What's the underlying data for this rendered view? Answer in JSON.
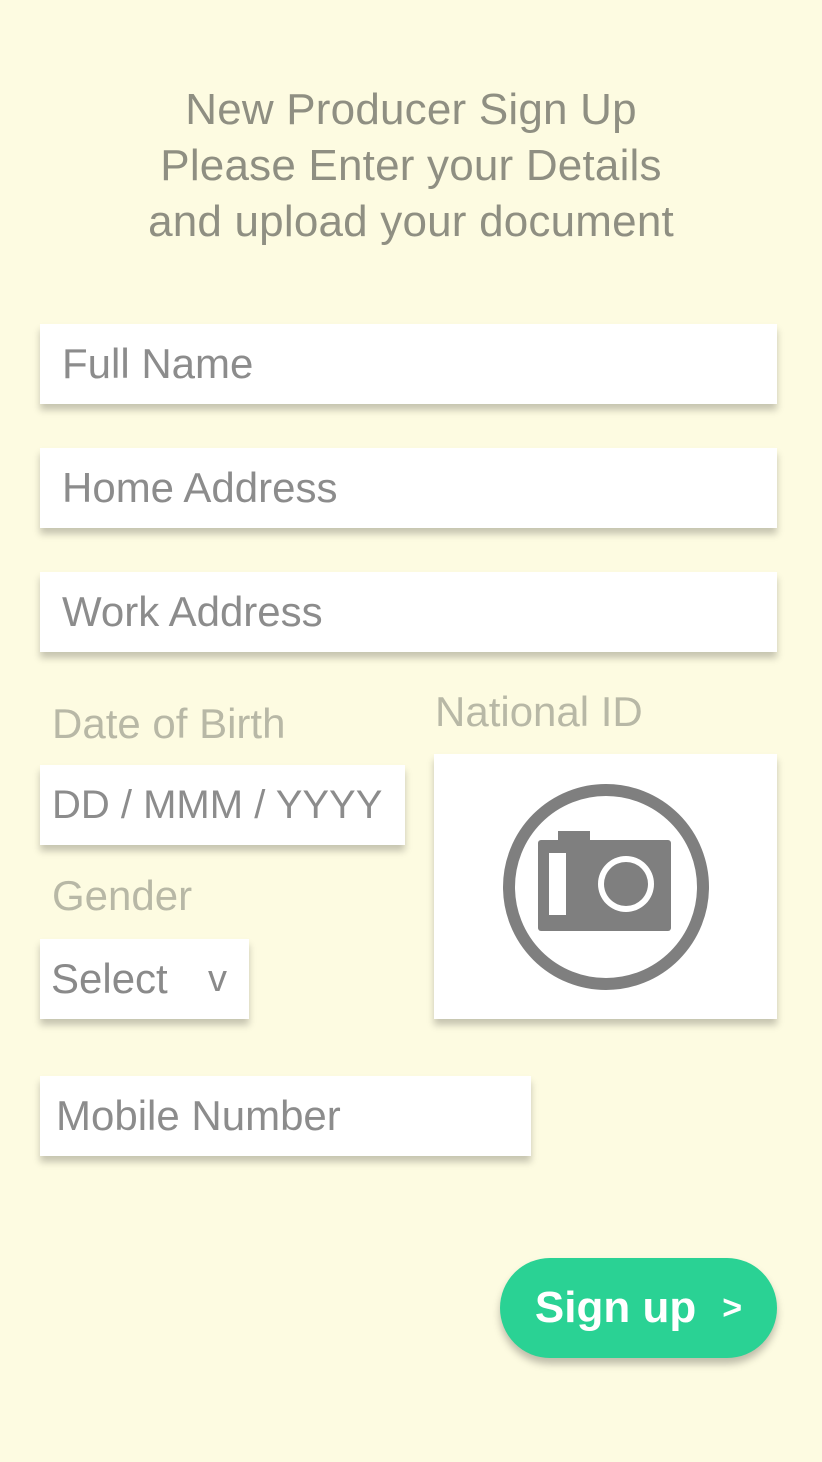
{
  "header": {
    "line1": "New Producer Sign Up",
    "line2": "Please Enter your Details",
    "line3": "and upload your document"
  },
  "form": {
    "full_name": {
      "placeholder": "Full Name",
      "value": ""
    },
    "home_address": {
      "placeholder": "Home Address",
      "value": ""
    },
    "work_address": {
      "placeholder": "Work Address",
      "value": ""
    },
    "dob": {
      "label": "Date of Birth",
      "placeholder": "DD / MMM / YYYY",
      "value": ""
    },
    "gender": {
      "label": "Gender",
      "selected": "Select",
      "chevron": "v"
    },
    "national_id": {
      "label": "National ID",
      "icon": "camera-icon"
    },
    "mobile": {
      "placeholder": "Mobile Number",
      "value": ""
    }
  },
  "signup_button": {
    "label": "Sign up",
    "arrow": ">"
  },
  "colors": {
    "background": "#fdfbe1",
    "accent": "#2ad294",
    "text_muted": "#8f8f82",
    "icon": "#7f7f7f"
  }
}
